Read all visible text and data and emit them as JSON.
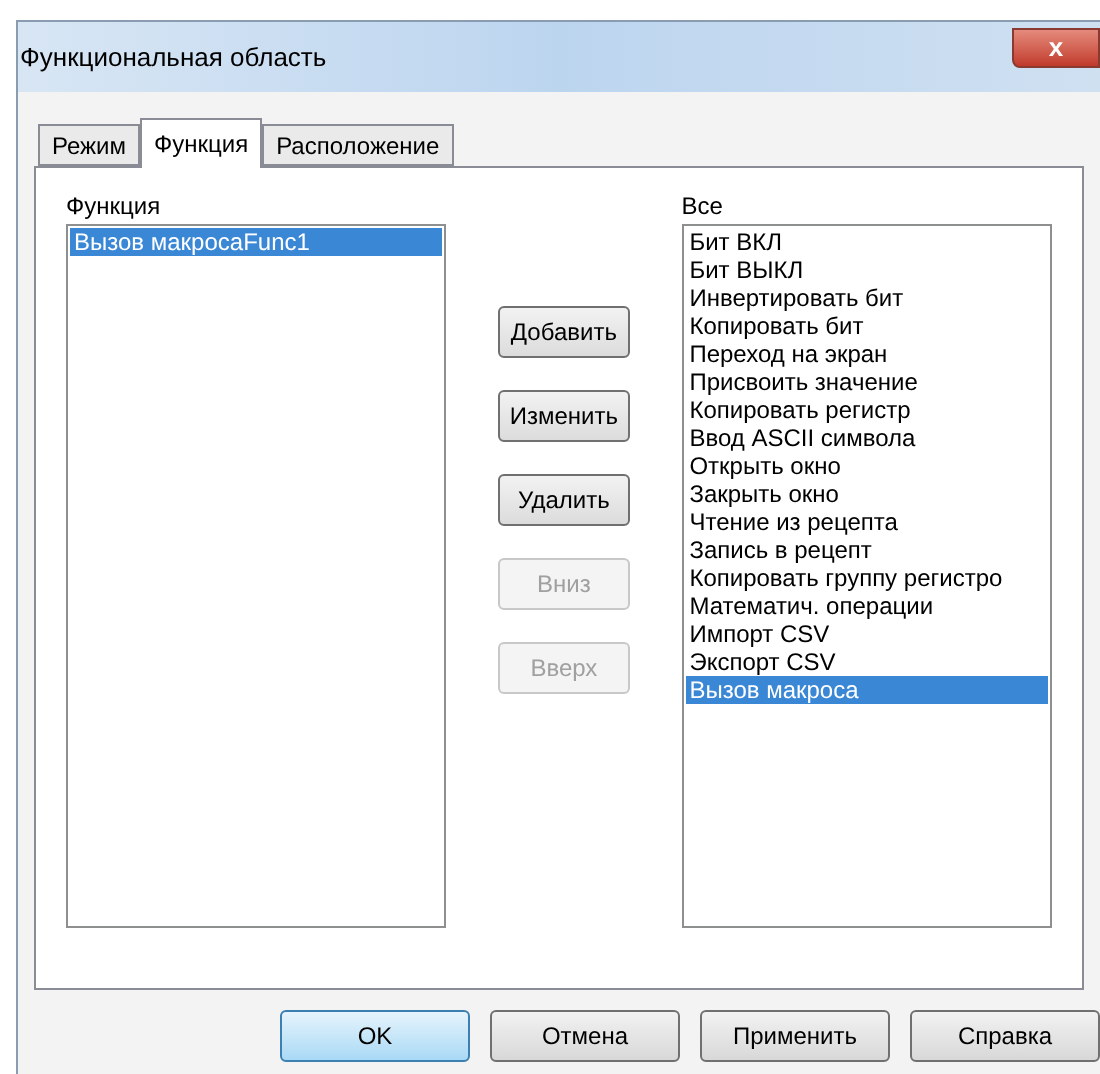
{
  "window": {
    "title": "Функциональная область",
    "close_label": "x"
  },
  "tabs": [
    {
      "label": "Режим",
      "selected": false
    },
    {
      "label": "Функция",
      "selected": true
    },
    {
      "label": "Расположение",
      "selected": false
    }
  ],
  "function_list": {
    "label": "Функция",
    "items": [
      {
        "label": "Вызов макросаFunc1",
        "selected": true
      }
    ]
  },
  "actions": [
    {
      "label": "Добавить",
      "disabled": false
    },
    {
      "label": "Изменить",
      "disabled": false
    },
    {
      "label": "Удалить",
      "disabled": false
    },
    {
      "label": "Вниз",
      "disabled": true
    },
    {
      "label": "Вверх",
      "disabled": true
    }
  ],
  "all_list": {
    "label": "Все",
    "items": [
      {
        "label": "Бит ВКЛ",
        "selected": false
      },
      {
        "label": "Бит ВЫКЛ",
        "selected": false
      },
      {
        "label": "Инвертировать бит",
        "selected": false
      },
      {
        "label": "Копировать бит",
        "selected": false
      },
      {
        "label": "Переход на экран",
        "selected": false
      },
      {
        "label": "Присвоить значение",
        "selected": false
      },
      {
        "label": "Копировать регистр",
        "selected": false
      },
      {
        "label": "Ввод ASCII символа",
        "selected": false
      },
      {
        "label": "Открыть окно",
        "selected": false
      },
      {
        "label": "Закрыть окно",
        "selected": false
      },
      {
        "label": "Чтение из рецепта",
        "selected": false
      },
      {
        "label": "Запись в рецепт",
        "selected": false
      },
      {
        "label": "Копировать группу регистро",
        "selected": false
      },
      {
        "label": "Математич. операции",
        "selected": false
      },
      {
        "label": "Импорт CSV",
        "selected": false
      },
      {
        "label": "Экспорт CSV",
        "selected": false
      },
      {
        "label": "Вызов макроса",
        "selected": true
      }
    ]
  },
  "buttons": [
    {
      "label": "OK",
      "default": true
    },
    {
      "label": "Отмена",
      "default": false
    },
    {
      "label": "Применить",
      "default": false
    },
    {
      "label": "Справка",
      "default": false
    }
  ]
}
